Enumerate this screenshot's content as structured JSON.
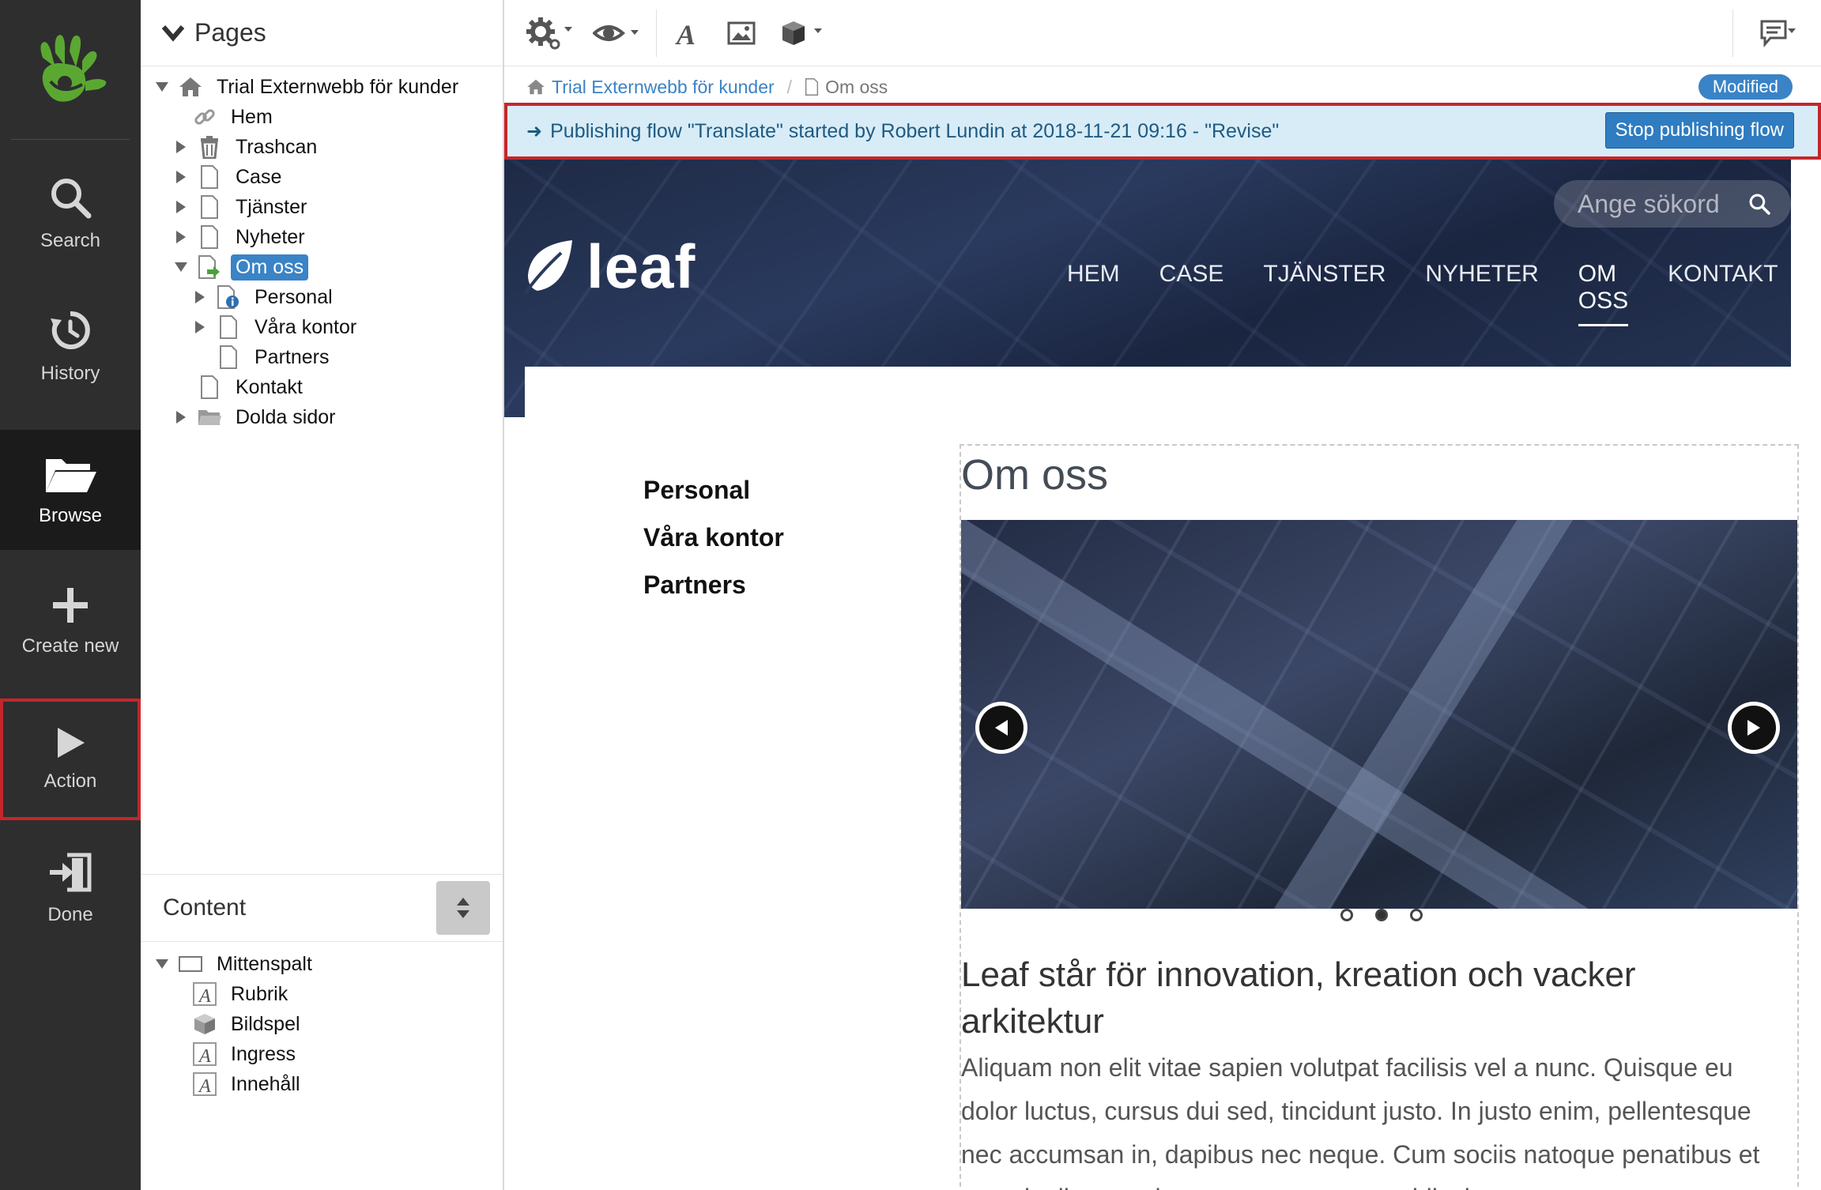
{
  "rail": {
    "items": [
      {
        "label": "Search",
        "icon": "search-icon"
      },
      {
        "label": "History",
        "icon": "history-icon"
      },
      {
        "label": "Browse",
        "icon": "folder-icon"
      },
      {
        "label": "Create new",
        "icon": "plus-icon"
      },
      {
        "label": "Action",
        "icon": "play-icon"
      },
      {
        "label": "Done",
        "icon": "exit-icon"
      }
    ],
    "active": "Browse",
    "highlighted": "Action"
  },
  "tree": {
    "title": "Pages",
    "nodes": [
      {
        "label": "Trial Externwebb för kunder",
        "icon": "home-icon",
        "expanded": true
      },
      {
        "label": "Hem",
        "icon": "link-icon"
      },
      {
        "label": "Trashcan",
        "icon": "trash-icon"
      },
      {
        "label": "Case",
        "icon": "page-icon"
      },
      {
        "label": "Tjänster",
        "icon": "page-icon"
      },
      {
        "label": "Nyheter",
        "icon": "page-icon"
      },
      {
        "label": "Om oss",
        "icon": "page-publish-icon",
        "selected": true
      },
      {
        "label": "Personal",
        "icon": "page-info-icon"
      },
      {
        "label": "Våra kontor",
        "icon": "page-icon"
      },
      {
        "label": "Partners",
        "icon": "page-icon"
      },
      {
        "label": "Kontakt",
        "icon": "page-icon"
      },
      {
        "label": "Dolda sidor",
        "icon": "folder-icon"
      }
    ]
  },
  "content": {
    "title": "Content",
    "nodes": [
      {
        "label": "Mittenspalt",
        "icon": "area-icon"
      },
      {
        "label": "Rubrik",
        "icon": "text-icon"
      },
      {
        "label": "Bildspel",
        "icon": "cube-icon"
      },
      {
        "label": "Ingress",
        "icon": "text-icon"
      },
      {
        "label": "Innehåll",
        "icon": "text-icon"
      }
    ]
  },
  "breadcrumb": {
    "root": "Trial Externwebb för kunder",
    "current": "Om oss",
    "status": "Modified"
  },
  "flow": {
    "message": "Publishing flow \"Translate\" started by Robert Lundin at 2018-11-21 09:16 - \"Revise\"",
    "stop_label": "Stop publishing flow"
  },
  "site": {
    "logo_text": "leaf",
    "search_placeholder": "Ange sökord",
    "nav": [
      "HEM",
      "CASE",
      "TJÄNSTER",
      "NYHETER",
      "OM OSS",
      "KONTAKT"
    ],
    "nav_active": "OM OSS",
    "subnav": [
      "Personal",
      "Våra kontor",
      "Partners"
    ],
    "page_title": "Om oss",
    "slides_total": 3,
    "slide_active": 2,
    "heading": "Leaf står för innovation, kreation och vacker arkitektur",
    "body": "Aliquam non elit vitae sapien volutpat facilisis vel a nunc. Quisque eu dolor luctus, cursus dui sed, tincidunt justo. In justo enim, pellentesque nec accumsan in, dapibus nec neque. Cum sociis natoque penatibus et magnis dis parturient montes, nascetur ridiculus"
  },
  "colors": {
    "accent": "#3a83c6",
    "highlight": "#c4262b",
    "logo_green": "#5aa832",
    "rail_bg": "#2e2e2e"
  }
}
